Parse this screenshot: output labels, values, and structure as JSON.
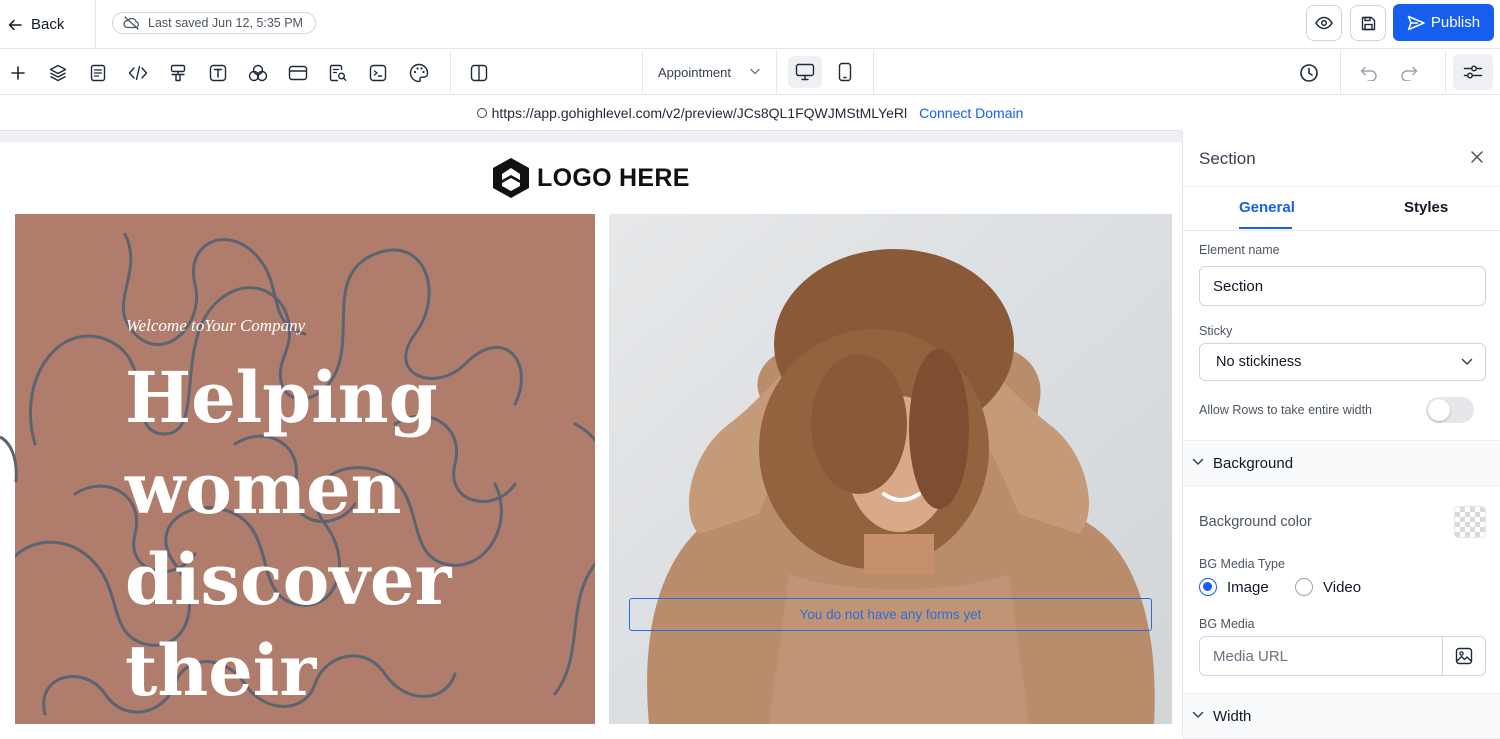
{
  "header": {
    "back_label": "Back",
    "saved_status": "Last saved Jun 12, 5:35 PM",
    "publish_label": "Publish"
  },
  "toolbar": {
    "tools": [
      "plus-icon",
      "layers-icon",
      "page-icon",
      "code-icon",
      "paint-roller-icon",
      "text-box-icon",
      "shapes-icon",
      "card-icon",
      "search-page-icon",
      "terminal-icon",
      "palette-icon",
      "columns-icon"
    ],
    "page_selector": "Appointment",
    "devices": [
      "desktop-icon",
      "mobile-icon"
    ]
  },
  "urlbar": {
    "url": "https://app.gohighlevel.com/v2/preview/JCs8QL1FQWJMStMLYeRl",
    "connect_label": "Connect Domain"
  },
  "canvas": {
    "logo_text": "LOGO HERE",
    "welcome": "Welcome toYour Company",
    "headline": "Helping women discover their",
    "forms_note": "You do not have any forms yet",
    "hero_left_color": "#b07d6c"
  },
  "panel": {
    "title": "Section",
    "tabs": {
      "general": "General",
      "styles": "Styles"
    },
    "element_name_label": "Element name",
    "element_name_value": "Section",
    "sticky_label": "Sticky",
    "sticky_value": "No stickiness",
    "full_width_label": "Allow Rows to take entire width",
    "full_width_on": false,
    "background_section": "Background",
    "bg_color_label": "Background color",
    "bg_media_type_label": "BG Media Type",
    "bg_media_type_options": [
      "Image",
      "Video"
    ],
    "bg_media_type_selected": "Image",
    "bg_media_label": "BG Media",
    "bg_media_placeholder": "Media URL",
    "width_section": "Width"
  },
  "colors": {
    "accent": "#155eef",
    "hero_brown": "#b07d6c",
    "line_art": "#5b6470"
  }
}
